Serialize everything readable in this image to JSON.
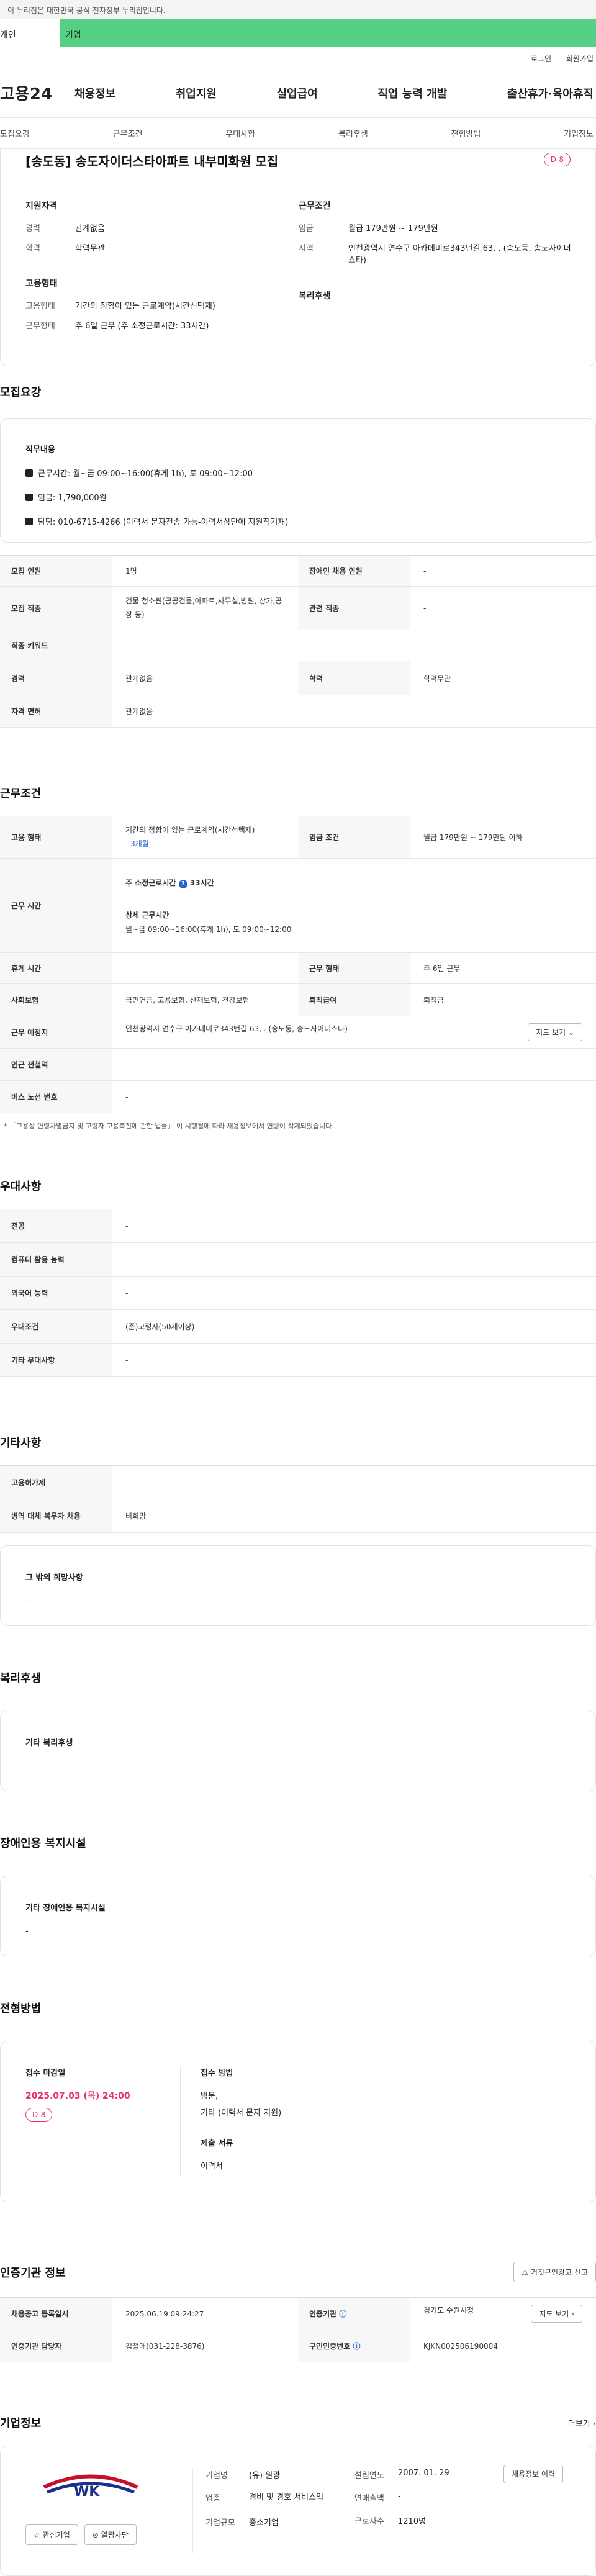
{
  "gov_bar": "이 누리집은 대한민국 공식 전자정부 누리집입니다.",
  "user_tabs": [
    "개인",
    "기업"
  ],
  "util": [
    "로그인",
    "회원가입"
  ],
  "logo": "고용24",
  "gnb": [
    "채용정보",
    "취업지원",
    "실업급여",
    "직업 능력 개발",
    "출산휴가·육아휴직"
  ],
  "anchor_tabs": [
    "모집요강",
    "근무조건",
    "우대사항",
    "복리후생",
    "전형방법",
    "기업정보"
  ],
  "summary": {
    "title": "[송도동] 송도자이더스타아파트 내부미화원 모집",
    "dday": "D-8",
    "qual_title": "지원자격",
    "career_label": "경력",
    "career_value": "관계없음",
    "edu_label": "학력",
    "edu_value": "학력무관",
    "work_title": "근무조건",
    "wage_label": "임금",
    "wage_value": "월급 179만원 ~ 179만원",
    "region_label": "지역",
    "region_value": "인천광역시 연수구 아카데미로343번길 63, . (송도동, 송도자이더스타)",
    "emp_title": "고용형태",
    "emptype_label": "고용형태",
    "emptype_value": "기간의 정함이 있는 근로계약(시간선택제)",
    "worktype_label": "근무형태",
    "worktype_value": "주 6일 근무 (주 소정근로시간: 33시간)",
    "welfare_title": "복리후생"
  },
  "recruit": {
    "heading": "모집요강",
    "duty_title": "직무내용",
    "duties": [
      "근무시간: 월~금 09:00~16:00(휴게 1h), 토 09:00~12:00",
      "임금: 1,790,000원",
      "담당: 010-6715-4266 (이력서 문자전송 가능-이력서상단에 지원직기재)"
    ],
    "table": [
      [
        "모집 인원",
        "1명",
        "장애인 채용 인원",
        "-"
      ],
      [
        "모집 직종",
        "건물 청소원(공공건물,아파트,사무실,병원, 상가,공장 등)",
        "관련 직종",
        "-"
      ],
      [
        "직종 키워드",
        "-"
      ],
      [
        "경력",
        "관계없음",
        "학력",
        "학력무관"
      ],
      [
        "자격 면허",
        "관계없음"
      ]
    ]
  },
  "conditions": {
    "heading": "근무조건",
    "emp_label": "고용 형태",
    "emp_value": "기간의 정함이 있는 근로계약(시간선택제)",
    "emp_period": "- 3개월",
    "wage_label": "임금 조건",
    "wage_value": "월급 179만원 ~ 179만원 이하",
    "time_label": "근무 시간",
    "weekly_hours_label": "주 소정근로시간",
    "weekly_hours": "33시간",
    "detail_label": "상세 근무시간",
    "detail_value": "월~금 09:00~16:00(휴게 1h), 토 09:00~12:00",
    "rows": [
      [
        "휴게 시간",
        "-",
        "근무 형태",
        "주 6일 근무"
      ],
      [
        "사회보험",
        "국민연금, 고용보험, 산재보험, 건강보험",
        "퇴직급여",
        "퇴직금"
      ]
    ],
    "place_label": "근무 예정지",
    "place_value": "인천광역시 연수구 아카데미로343번길 63, . (송도동, 송도자이더스타)",
    "map_btn": "지도 보기",
    "station_label": "인근 전철역",
    "station_value": "-",
    "bus_label": "버스 노선 번호",
    "bus_value": "-",
    "note": "* 「고용상 연령차별금지 및 고령자 고용촉진에 관한 법률」 이 시행됨에 따라 채용정보에서 연령이 삭제되었습니다."
  },
  "pref": {
    "heading": "우대사항",
    "rows": [
      [
        "전공",
        "-"
      ],
      [
        "컴퓨터 활용 능력",
        "-"
      ],
      [
        "외국어 능력",
        "-"
      ],
      [
        "우대조건",
        "(준)고령자(50세이상)"
      ],
      [
        "기타 우대사항",
        "-"
      ]
    ]
  },
  "etc": {
    "heading": "기타사항",
    "rows": [
      [
        "고용허가제",
        "-"
      ],
      [
        "병역 대체 복무자 채용",
        "비희망"
      ]
    ],
    "box_title": "그 밖의 희망사항",
    "box_value": "-"
  },
  "welfare": {
    "heading": "복리후생",
    "box_title": "기타 복리후생",
    "box_value": "-"
  },
  "disabled": {
    "heading": "장애인용 복지시설",
    "box_title": "기타 장애인용 복지시설",
    "box_value": "-"
  },
  "process": {
    "heading": "전형방법",
    "deadline_label": "접수 마감일",
    "deadline": "2025.07.03 (목) 24:00",
    "dday": "D-8",
    "method_label": "접수 방법",
    "method_value": "방문,",
    "method_value2": "기타 (이력서 문자 지원)",
    "docs_label": "제출 서류",
    "docs_value": "이력서"
  },
  "agency": {
    "heading": "인증기관 정보",
    "report_btn": "거짓구인광고 신고",
    "rows": [
      [
        "채용공고 등록일시",
        "2025.06.19 09:24:27",
        "인증기관",
        "경기도 수원시청"
      ],
      [
        "인증기관 담당자",
        "김정애(031-228-3876)",
        "구인인증번호",
        "KJKN002506190004"
      ]
    ],
    "map_btn": "지도 보기"
  },
  "company": {
    "heading": "기업정보",
    "more": "더보기",
    "favorite": "관심기업",
    "block": "열람차단",
    "name_label": "기업명",
    "name_value": "(유) 원광",
    "industry_label": "업종",
    "industry_value": "경비 및 경호 서비스업",
    "size_label": "기업규모",
    "size_value": "중소기업",
    "founded_label": "설립연도",
    "founded_value": "2007. 01. 29",
    "sales_label": "연매출액",
    "sales_value": "-",
    "staff_label": "근로자수",
    "staff_value": "1210명",
    "jobs_btn": "채용정보 이력",
    "accent": "#e9336a",
    "primary": "#55d084"
  }
}
